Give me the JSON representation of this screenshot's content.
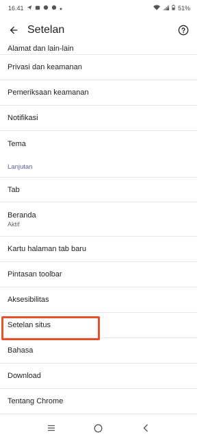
{
  "status_bar": {
    "time": "16.41",
    "battery": "51%"
  },
  "app_bar": {
    "title": "Setelan"
  },
  "settings": {
    "items": [
      {
        "label": "Alamat dan lain-lain"
      },
      {
        "label": "Privasi dan keamanan"
      },
      {
        "label": "Pemeriksaan keamanan"
      },
      {
        "label": "Notifikasi"
      },
      {
        "label": "Tema"
      }
    ],
    "section_header": "Lanjutan",
    "advanced_items": [
      {
        "label": "Tab"
      },
      {
        "label": "Beranda",
        "subtitle": "Aktif"
      },
      {
        "label": "Kartu halaman tab baru"
      },
      {
        "label": "Pintasan toolbar"
      },
      {
        "label": "Aksesibilitas"
      },
      {
        "label": "Setelan situs"
      },
      {
        "label": "Bahasa"
      },
      {
        "label": "Download"
      },
      {
        "label": "Tentang Chrome"
      }
    ]
  },
  "annotation": {
    "highlight_color": "#e4502b"
  },
  "icons": {
    "back": "arrow-left-icon",
    "help": "help-circle-icon",
    "nav_recents": "recents-icon",
    "nav_home": "home-icon",
    "nav_back": "back-chevron-icon"
  }
}
